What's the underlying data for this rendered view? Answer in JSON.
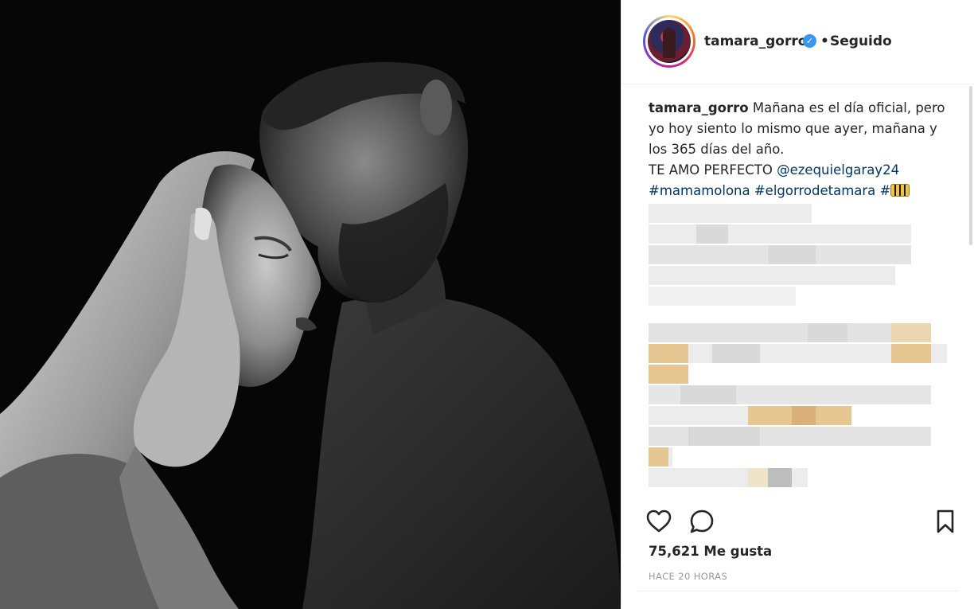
{
  "photo": {
    "alt_name": "couple-photo"
  },
  "header": {
    "username": "tamara_gorro",
    "verified_icon": "verified-badge-icon",
    "separator": "•",
    "follow_status": "Seguido"
  },
  "caption": {
    "username": "tamara_gorro",
    "text_line1": "Mañana es el día oficial, pero yo hoy siento lo mismo que ayer, mañana y los 365 días del año.",
    "text_line2": "TE AMO PERFECTO",
    "mention": "@ezequielgaray24",
    "hashtag1": "#mamamolona",
    "hashtag2": "#elgorrodetamara",
    "hashtag3": "#"
  },
  "actions": {
    "like_icon": "heart-icon",
    "comment_icon": "comment-icon",
    "save_icon": "bookmark-icon"
  },
  "likes": "75,621 Me gusta",
  "timestamp": "HACE 20 HORAS",
  "colors": {
    "link": "#003569",
    "verified": "#3897f0",
    "muted": "#999999"
  }
}
